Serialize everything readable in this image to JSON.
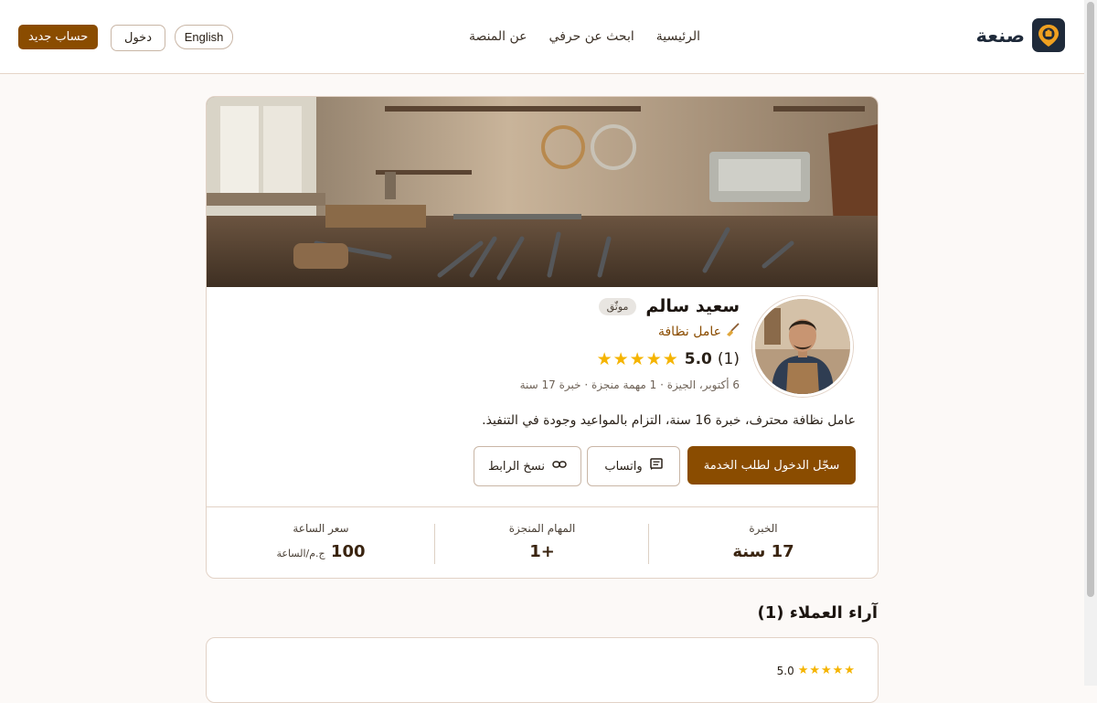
{
  "header": {
    "brand": "صنعة",
    "nav": [
      "الرئيسية",
      "ابحث عن حرفي",
      "عن المنصة"
    ],
    "lang_label": "English",
    "login_label": "دخول",
    "signup_label": "حساب جديد"
  },
  "profile": {
    "name": "سعيد سالم",
    "verified_badge": "موثّق",
    "profession": "عامل نظافة",
    "profession_icon": "broom-icon",
    "rating_value": "5.0",
    "rating_count": "(1)",
    "stars": "★★★★★",
    "meta": "6 أكتوبر، الجيزة · 1 مهمة منجزة · خبرة 17 سنة",
    "bio": "عامل نظافة محترف، خبرة 16 سنة، التزام بالمواعيد وجودة في التنفيذ.",
    "primary_button": "سجّل الدخول لطلب الخدمة",
    "whatsapp_button": "واتساب",
    "copy_link_button": "نسخ الرابط"
  },
  "stats": {
    "experience": {
      "label": "الخبرة",
      "value": "17 سنة"
    },
    "tasks": {
      "label": "المهام المنجزة",
      "value": "1+"
    },
    "rate": {
      "label": "سعر الساعة",
      "value": "100",
      "unit": "ج.م/الساعة"
    }
  },
  "reviews": {
    "title": "آراء العملاء (1)",
    "items": [
      {
        "rating": "5.0",
        "stars": "★★★★★"
      }
    ]
  },
  "colors": {
    "accent": "#8a4c00",
    "star": "#f5b400",
    "border": "#e2d2c6",
    "background": "#fcf9f7"
  }
}
